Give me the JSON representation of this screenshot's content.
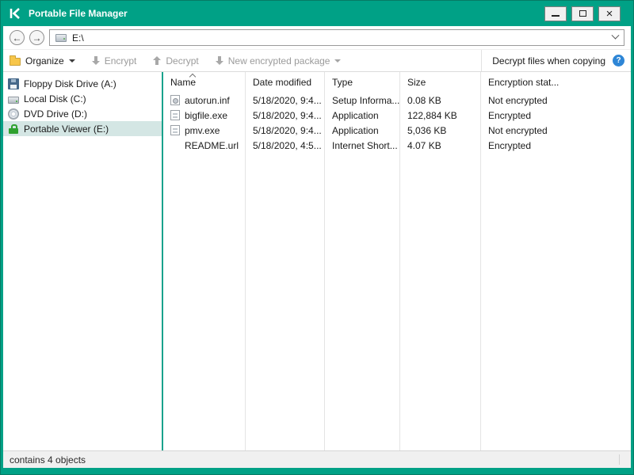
{
  "window": {
    "title": "Portable File Manager"
  },
  "navbar": {
    "address": "E:\\"
  },
  "toolbar": {
    "organize": "Organize",
    "encrypt": "Encrypt",
    "decrypt": "Decrypt",
    "new_encrypted_package": "New encrypted package",
    "decrypt_files_when_copying": "Decrypt files when copying"
  },
  "sidebar": {
    "items": [
      {
        "label": "Floppy Disk Drive (A:)",
        "icon": "floppy-icon",
        "selected": false
      },
      {
        "label": "Local Disk (C:)",
        "icon": "hard-disk-icon",
        "selected": false
      },
      {
        "label": "DVD Drive (D:)",
        "icon": "dvd-icon",
        "selected": false
      },
      {
        "label": "Portable Viewer (E:)",
        "icon": "lock-icon",
        "selected": true
      }
    ]
  },
  "files": {
    "columns": [
      "Name",
      "Date modified",
      "Type",
      "Size",
      "Encryption stat..."
    ],
    "sorted_by": "Name",
    "sort_direction": "ascending",
    "rows": [
      {
        "icon": "setup-information-file-icon",
        "name": "autorun.inf",
        "date": "5/18/2020, 9:4...",
        "type": "Setup Informa...",
        "size": "0.08 KB",
        "encryption": "Not encrypted"
      },
      {
        "icon": "application-file-icon",
        "name": "bigfile.exe",
        "date": "5/18/2020, 9:4...",
        "type": "Application",
        "size": "122,884 KB",
        "encryption": "Encrypted"
      },
      {
        "icon": "application-file-icon",
        "name": "pmv.exe",
        "date": "5/18/2020, 9:4...",
        "type": "Application",
        "size": "5,036 KB",
        "encryption": "Not encrypted"
      },
      {
        "icon": "none",
        "name": "README.url",
        "date": "5/18/2020, 4:5...",
        "type": "Internet Short...",
        "size": "4.07 KB",
        "encryption": "Encrypted"
      }
    ]
  },
  "statusbar": {
    "text": "contains 4 objects"
  },
  "icons": {
    "logo": "kaspersky-k",
    "back": "arrow-left",
    "forward": "arrow-right",
    "address_drive": "drive",
    "address_dropdown": "chevron-down",
    "organize": "folder",
    "encrypt": "gray-arrow-down",
    "decrypt": "gray-arrow-up",
    "new_encrypted_package": "gray-arrow-down",
    "help": "question-mark-circle",
    "minimize": "minus",
    "maximize": "square",
    "close": "x"
  },
  "colors": {
    "brand_teal": "#00a186",
    "selection": "#d4e6e4",
    "disabled_text": "#9b9b9b",
    "help_blue": "#2e86d6",
    "statusbar_bg": "#f0f0f0"
  }
}
